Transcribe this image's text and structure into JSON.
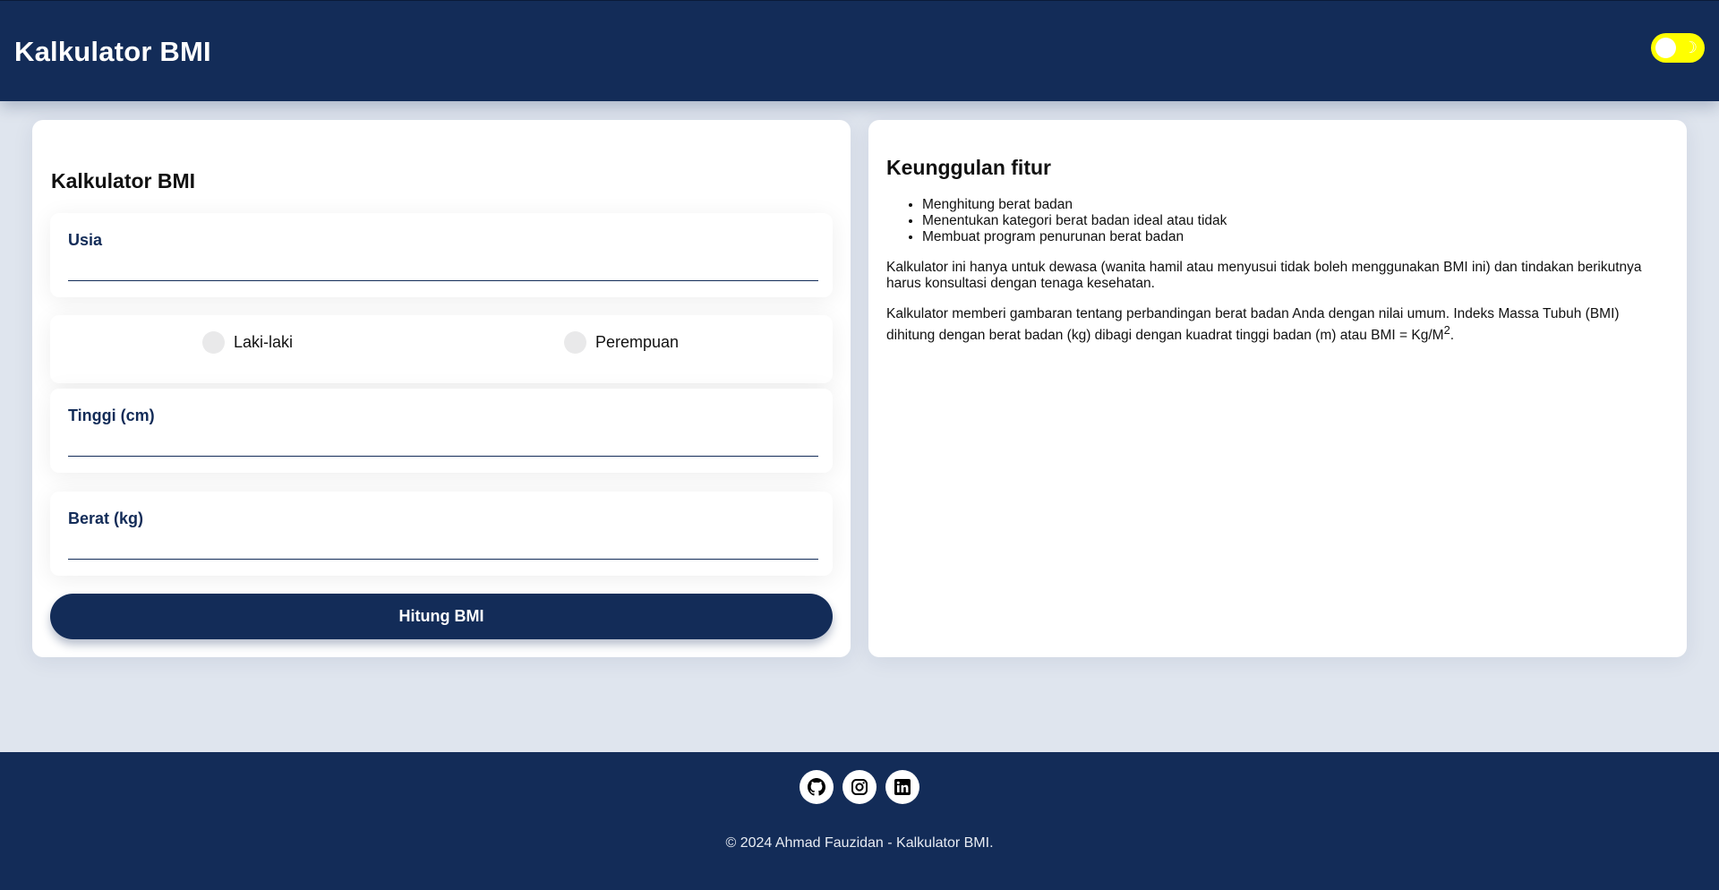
{
  "header": {
    "title": "Kalkulator BMI",
    "toggle_icon": "moon-icon"
  },
  "form": {
    "title": "Kalkulator BMI",
    "fields": {
      "usia": {
        "label": "Usia",
        "value": ""
      },
      "tinggi": {
        "label": "Tinggi (cm)",
        "value": ""
      },
      "berat": {
        "label": "Berat (kg)",
        "value": ""
      }
    },
    "gender": {
      "options": [
        "Laki-laki",
        "Perempuan"
      ]
    },
    "submit_label": "Hitung BMI"
  },
  "features": {
    "title": "Keunggulan fitur",
    "items": [
      "Menghitung berat badan",
      "Menentukan kategori berat badan ideal atau tidak",
      "Membuat program penurunan berat badan"
    ],
    "paragraph1": "Kalkulator ini hanya untuk dewasa (wanita hamil atau menyusui tidak boleh menggunakan BMI ini) dan tindakan berikutnya harus konsultasi dengan tenaga kesehatan.",
    "paragraph2": "Kalkulator memberi gambaran tentang perbandingan berat badan Anda dengan nilai umum. Indeks Massa Tubuh (BMI) dihitung dengan berat badan (kg) dibagi dengan kuadrat tinggi badan (m) atau BMI = Kg/M",
    "paragraph2_sup": "2",
    "paragraph2_end": "."
  },
  "footer": {
    "social_icons": [
      "github-icon",
      "instagram-icon",
      "linkedin-icon"
    ],
    "copyright": "© 2024 Ahmad Fauzidan - Kalkulator BMI."
  },
  "colors": {
    "primary": "#132c58",
    "background": "#dfe5ee",
    "toggle": "#ffff00"
  }
}
